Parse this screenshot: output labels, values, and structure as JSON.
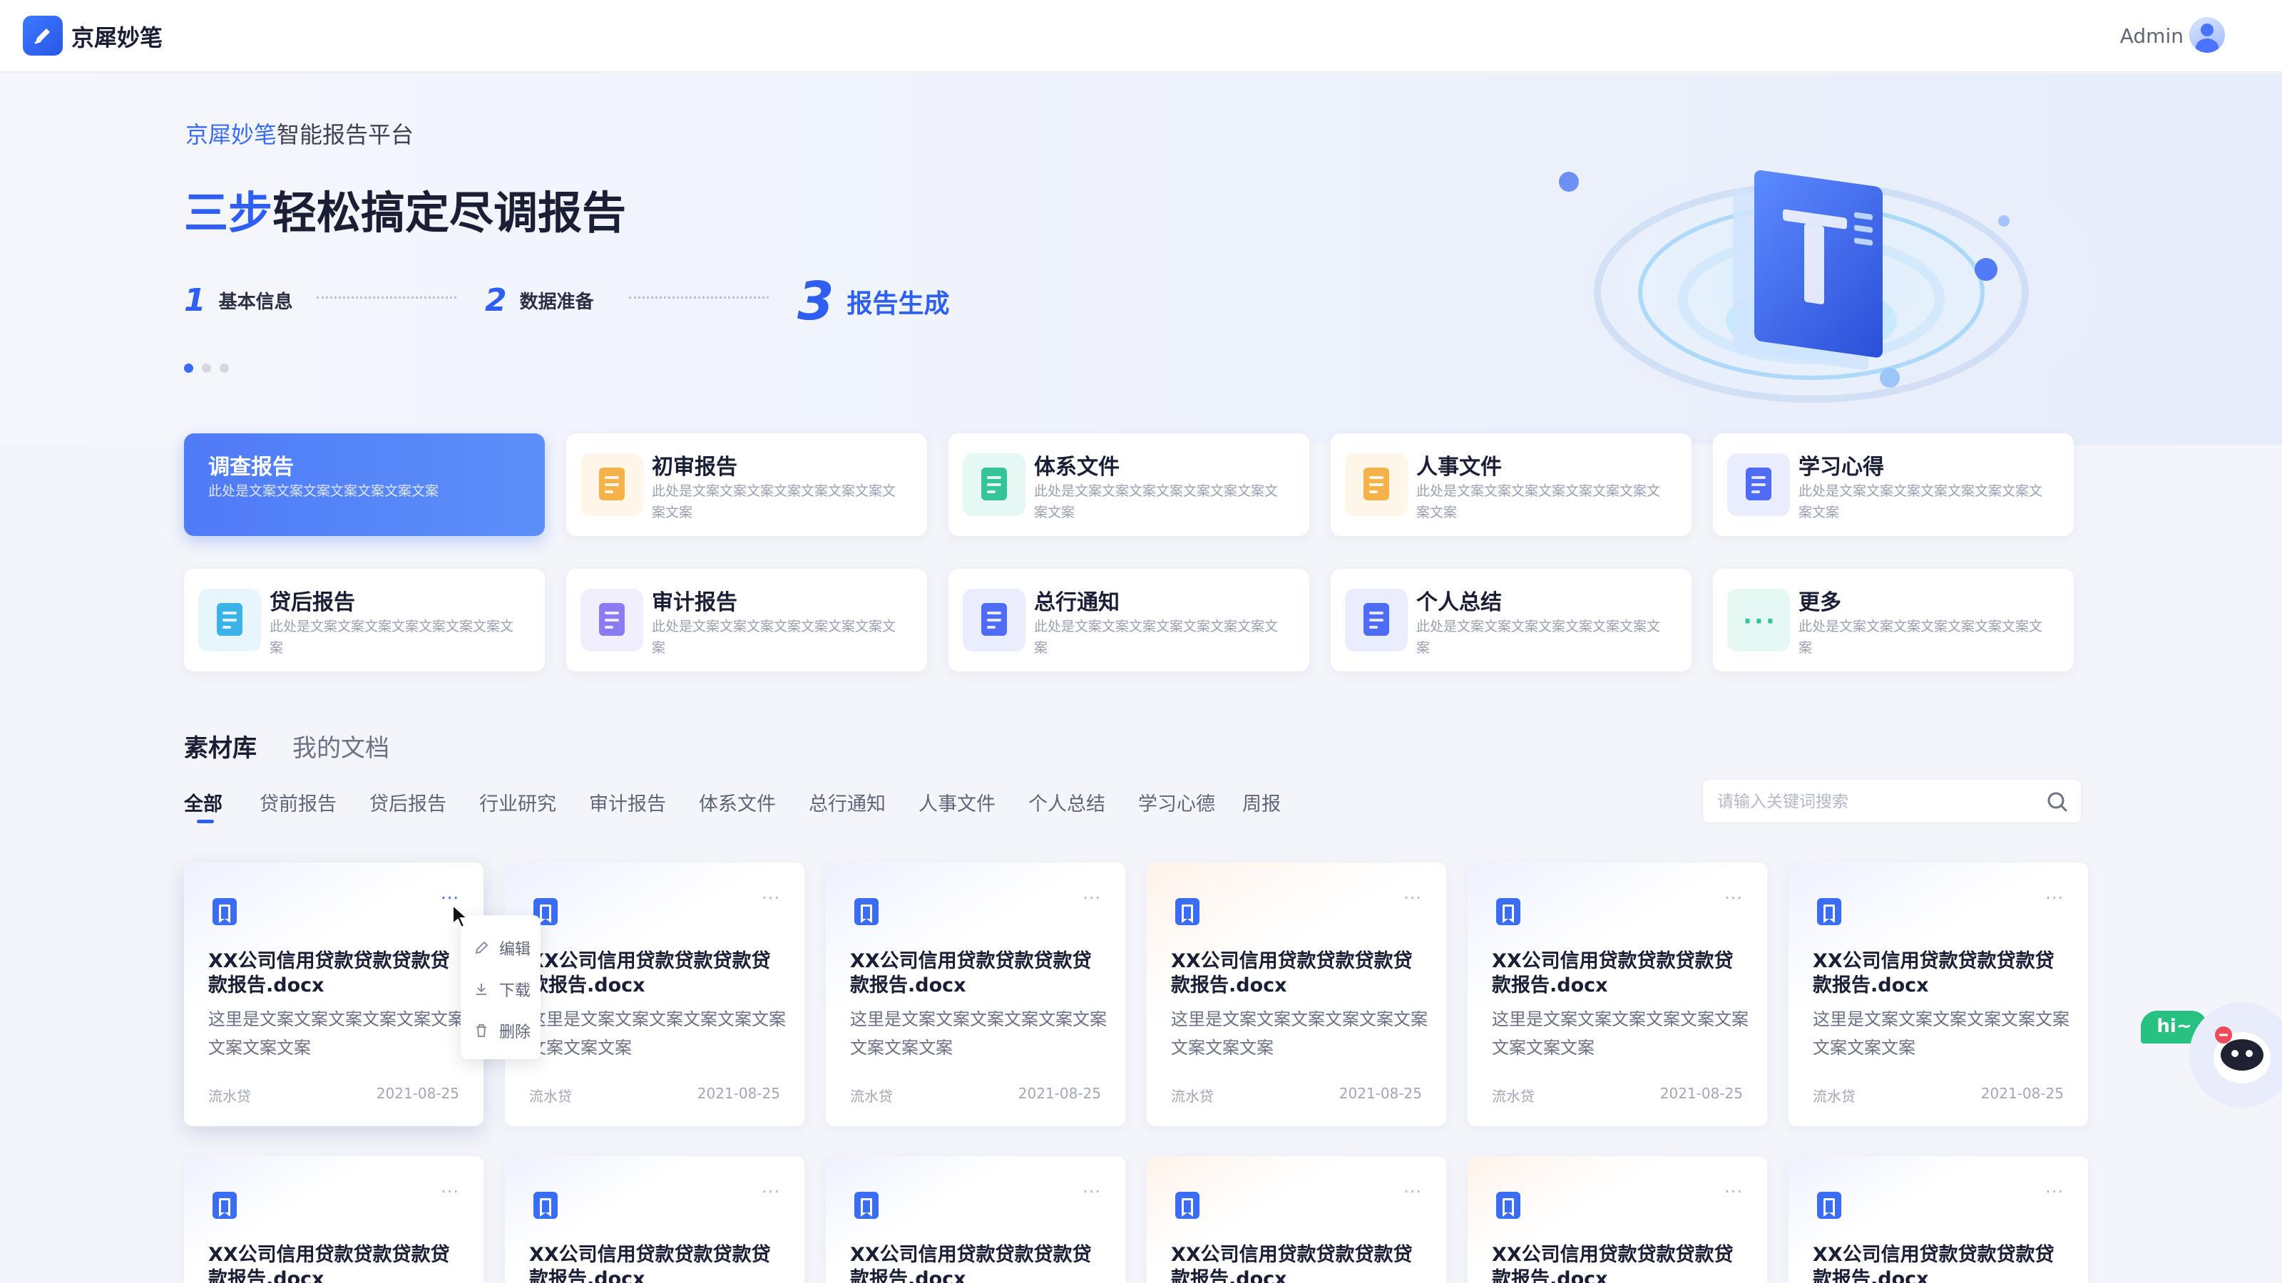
{
  "app": {
    "title": "京犀妙笔",
    "user": "Admin"
  },
  "hero": {
    "brand_accent": "京犀妙笔",
    "brand_rest": "智能报告平台",
    "title_accent": "三步",
    "title_rest": "轻松搞定尽调报告",
    "steps": [
      {
        "num": "1",
        "label": "基本信息"
      },
      {
        "num": "2",
        "label": "数据准备"
      },
      {
        "num": "3",
        "label": "报告生成",
        "active": true
      }
    ],
    "carousel": {
      "count": 3,
      "active": 1
    }
  },
  "categories": [
    {
      "title": "调查报告",
      "desc": "此处是文案文案文案文案文案文案文案",
      "active": true,
      "icon": "survey-report-icon",
      "color": "#4f7bf7"
    },
    {
      "title": "初审报告",
      "desc": "此处是文案文案文案文案文案文案文案文案文案",
      "icon": "preliminary-review-icon",
      "color": "#f6b24a"
    },
    {
      "title": "体系文件",
      "desc": "此处是文案文案文案文案文案文案文案文案文案",
      "icon": "system-document-icon",
      "color": "#35c49a"
    },
    {
      "title": "人事文件",
      "desc": "此处是文案文案文案文案文案文案文案文案文案",
      "icon": "personnel-file-icon",
      "color": "#f6b24a"
    },
    {
      "title": "学习心得",
      "desc": "此处是文案文案文案文案文案文案文案文案文案",
      "icon": "learning-notes-icon",
      "color": "#4f6cf4"
    },
    {
      "title": "贷后报告",
      "desc": "此处是文案文案文案文案文案文案文案文案",
      "icon": "post-loan-report-icon",
      "color": "#3bb3e6"
    },
    {
      "title": "审计报告",
      "desc": "此处是文案文案文案文案文案文案文案文案",
      "icon": "audit-report-icon",
      "color": "#8b7bf0"
    },
    {
      "title": "总行通知",
      "desc": "此处是文案文案文案文案文案文案文案文案",
      "icon": "head-office-notice-icon",
      "color": "#4f6cf4"
    },
    {
      "title": "个人总结",
      "desc": "此处是文案文案文案文案文案文案文案文案",
      "icon": "personal-summary-icon",
      "color": "#4f6cf4"
    },
    {
      "title": "更多",
      "desc": "此处是文案文案文案文案文案文案文案文案",
      "icon": "more-icon",
      "color": "#35c49a"
    }
  ],
  "library": {
    "tabs": [
      "素材库",
      "我的文档"
    ],
    "filters": [
      "全部",
      "贷前报告",
      "贷后报告",
      "行业研究",
      "审计报告",
      "体系文件",
      "总行通知",
      "人事文件",
      "个人总结",
      "学习心德",
      "周报"
    ],
    "search_placeholder": "请输入关键词搜索"
  },
  "documents": {
    "row1": [
      {
        "title": "XX公司信用贷款贷款贷款贷款报告.docx",
        "desc": "这里是文案文案文案文案文案文案文案文案文案",
        "tag": "流水贷",
        "date": "2021-08-25"
      },
      {
        "title": "XX公司信用贷款贷款贷款贷款报告.docx",
        "desc": "这里是文案文案文案文案文案文案文案文案文案",
        "tag": "流水贷",
        "date": "2021-08-25"
      },
      {
        "title": "XX公司信用贷款贷款贷款贷款报告.docx",
        "desc": "这里是文案文案文案文案文案文案文案文案文案",
        "tag": "流水贷",
        "date": "2021-08-25"
      },
      {
        "title": "XX公司信用贷款贷款贷款贷款报告.docx",
        "desc": "这里是文案文案文案文案文案文案文案文案文案",
        "tag": "流水贷",
        "date": "2021-08-25"
      },
      {
        "title": "XX公司信用贷款贷款贷款贷款报告.docx",
        "desc": "这里是文案文案文案文案文案文案文案文案文案",
        "tag": "流水贷",
        "date": "2021-08-25"
      },
      {
        "title": "XX公司信用贷款贷款贷款贷款报告.docx",
        "desc": "这里是文案文案文案文案文案文案文案文案文案",
        "tag": "流水贷",
        "date": "2021-08-25"
      }
    ],
    "row2": [
      {
        "title": "XX公司信用贷款贷款贷款贷款报告.docx"
      },
      {
        "title": "XX公司信用贷款贷款贷款贷款报告.docx"
      },
      {
        "title": "XX公司信用贷款贷款贷款贷款报告.docx"
      },
      {
        "title": "XX公司信用贷款贷款贷款贷款报告.docx"
      },
      {
        "title": "XX公司信用贷款贷款贷款贷款报告.docx"
      },
      {
        "title": "XX公司信用贷款贷款贷款贷款报告.docx"
      }
    ],
    "more_label": "···"
  },
  "context_menu": {
    "items": [
      "编辑",
      "下载",
      "删除"
    ]
  },
  "assistant": {
    "greeting": "hi~"
  },
  "colors": {
    "accent": "#2f5ff2",
    "active_card": "#4f7bf7",
    "assistant": "#27c281",
    "doc_icon": "#3a6cf4"
  }
}
